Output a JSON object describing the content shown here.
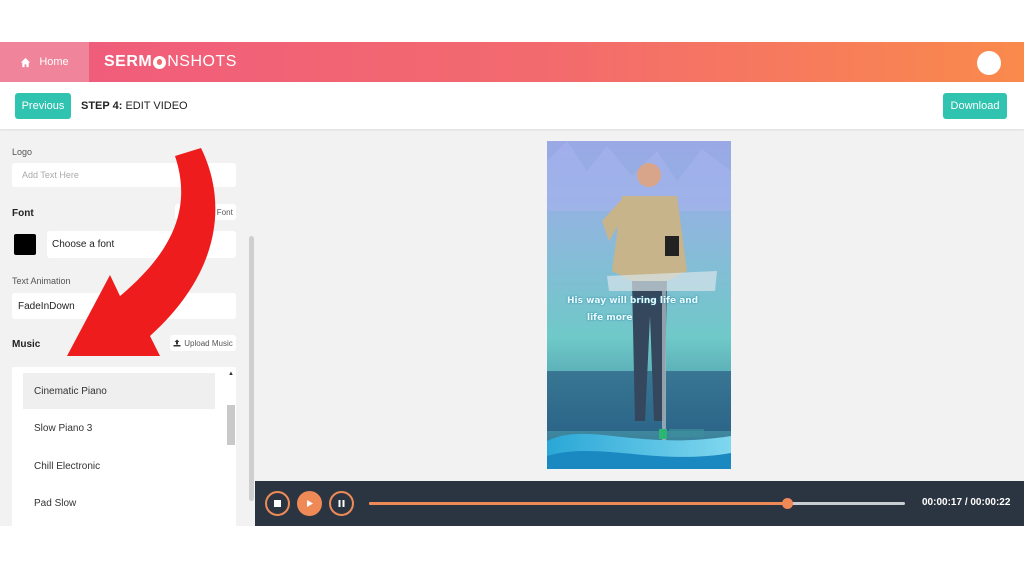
{
  "topbar": {
    "home_label": "Home",
    "brand_part1": "SERM",
    "brand_part2": "NSHOTS"
  },
  "stepbar": {
    "previous_label": "Previous",
    "step_prefix": "STEP 4:",
    "step_name": "EDIT VIDEO",
    "download_label": "Download"
  },
  "sidebar": {
    "logo_label": "Logo",
    "logo_placeholder": "Add Text Here",
    "font_label": "Font",
    "upload_font_label": "Upload Font",
    "font_value": "Choose a font",
    "font_color": "#000000",
    "text_animation_label": "Text Animation",
    "text_animation_value": "FadeInDown",
    "music_label": "Music",
    "upload_music_label": "Upload Music",
    "music_items": [
      "Cinematic Piano",
      "Slow Piano 3",
      "Chill Electronic",
      "Pad Slow"
    ],
    "selected_music": "Cinematic Piano"
  },
  "preview": {
    "caption_line1": "His way will bring life and",
    "caption_line2": "life more"
  },
  "player": {
    "progress": 0.78,
    "time_current": "00:00:17",
    "time_separator": "/",
    "time_total": "00:00:22",
    "accent_color": "#ef8a57"
  },
  "colors": {
    "teal": "#2fc3b0",
    "gradient_start": "#f05a7e",
    "gradient_end": "#fa8a4c",
    "arrow_red": "#ee1c1c"
  }
}
